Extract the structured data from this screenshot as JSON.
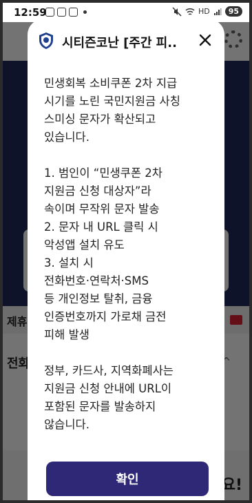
{
  "status_bar": {
    "time": "12:59",
    "battery": "95",
    "network": "HD"
  },
  "background_app": {
    "section_label": "제휴",
    "row_label": "전화",
    "banner_text": "요!"
  },
  "dialog": {
    "title": "시티즌코난 [주간 피..",
    "body_paragraphs": [
      "민생회복 소비쿠폰 2차 지급\n시기를 노린 국민지원금 사칭\n스미싱 문자가 확산되고\n있습니다.",
      "1. 범인이 “민생쿠폰 2차\n지원금 신청 대상자”라\n속이며 무작위 문자 발송\n2. 문자 내 URL 클릭 시\n악성앱 설치 유도\n3. 설치 시\n전화번호·연락처·SMS\n등 개인정보 탈취, 금융\n인증번호까지 가로채 금전\n피해 발생",
      "정부, 카드사, 지역화폐사는\n지원금 신청 안내에 URL이\n포함된 문자를 발송하지\n않습니다."
    ],
    "confirm_label": "확인",
    "accent_color": "#2f2877",
    "icons": {
      "logo": "shield-icon",
      "close": "close-icon"
    }
  }
}
